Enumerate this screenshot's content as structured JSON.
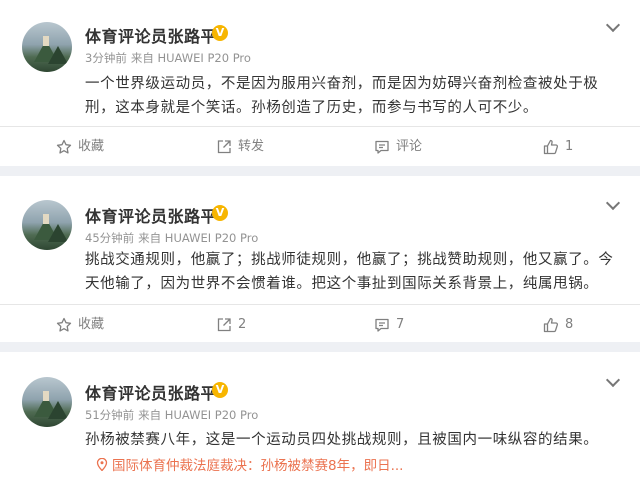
{
  "posts": [
    {
      "author": "体育评论员张路平",
      "verified_badge": "V",
      "time": "3分钟前",
      "source": "来自 HUAWEI P20 Pro",
      "text": "一个世界级运动员，不是因为服用兴奋剂，而是因为妨碍兴奋剂检查被处于极刑，这本身就是个笑话。孙杨创造了历史，而参与书写的人可不少。",
      "actions": {
        "favorite": "收藏",
        "repost": "转发",
        "comment": "评论",
        "like": "1"
      }
    },
    {
      "author": "体育评论员张路平",
      "verified_badge": "V",
      "time": "45分钟前",
      "source": "来自 HUAWEI P20 Pro",
      "text": "挑战交通规则，他赢了；挑战师徒规则，他赢了；挑战赞助规则，他又赢了。今天他输了，因为世界不会惯着谁。把这个事扯到国际关系背景上，纯属甩锅。",
      "actions": {
        "favorite": "收藏",
        "repost": "2",
        "comment": "7",
        "like": "8"
      }
    },
    {
      "author": "体育评论员张路平",
      "verified_badge": "V",
      "time": "51分钟前",
      "source": "来自 HUAWEI P20 Pro",
      "text": "孙杨被禁赛八年，这是一个运动员四处挑战规则，且被国内一味纵容的结果。",
      "link": "国际体育仲裁法庭裁决：孙杨被禁赛8年，即日..."
    }
  ],
  "colors": {
    "verified": "#f7b500",
    "link": "#eb7350",
    "text": "#333333",
    "meta": "#939393"
  },
  "icons": [
    "chevron-down-icon",
    "star-icon",
    "repost-icon",
    "comment-icon",
    "like-icon",
    "location-pin-icon"
  ]
}
